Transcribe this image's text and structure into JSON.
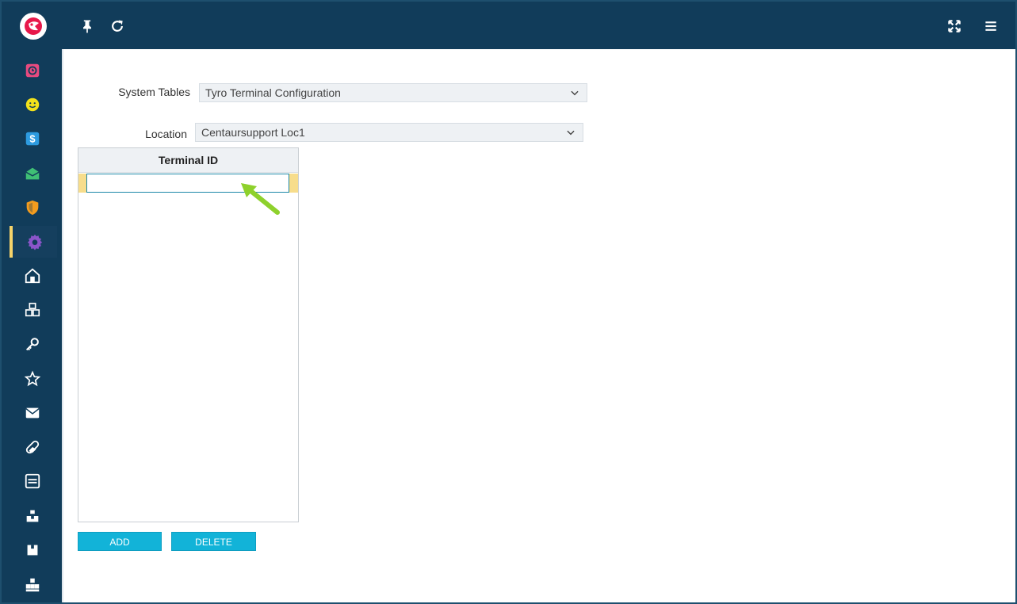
{
  "sidebar": {
    "items": [
      {
        "icon": "calendar-clock-icon",
        "color": "#e84a7f"
      },
      {
        "icon": "smiley-icon",
        "color": "#f3e21b"
      },
      {
        "icon": "dollar-icon",
        "color": "#2d9be0"
      },
      {
        "icon": "open-mail-icon",
        "color": "#3fbf75"
      },
      {
        "icon": "shield-icon",
        "color": "#f39c1e"
      },
      {
        "icon": "gear-icon",
        "color": "#8a55c9",
        "active": true
      },
      {
        "icon": "home-icon",
        "color": "#ffffff"
      },
      {
        "icon": "cubes-icon",
        "color": "#ffffff"
      },
      {
        "icon": "key-icon",
        "color": "#ffffff"
      },
      {
        "icon": "star-icon",
        "color": "#ffffff"
      },
      {
        "icon": "envelope-icon",
        "color": "#ffffff"
      },
      {
        "icon": "pill-icon",
        "color": "#ffffff"
      },
      {
        "icon": "list-box-icon",
        "color": "#ffffff"
      },
      {
        "icon": "hierarchy-icon",
        "color": "#ffffff"
      },
      {
        "icon": "box-icon",
        "color": "#ffffff"
      },
      {
        "icon": "boxes-stack-icon",
        "color": "#ffffff"
      }
    ]
  },
  "topbar": {
    "left_icons": [
      "pin-icon",
      "refresh-icon"
    ],
    "right_icons": [
      "fullscreen-icon",
      "menu-icon"
    ]
  },
  "form": {
    "system_tables_label": "System Tables",
    "system_tables_value": "Tyro Terminal Configuration",
    "location_label": "Location",
    "location_value": "Centaursupport Loc1"
  },
  "grid": {
    "header": "Terminal ID",
    "row_value": ""
  },
  "buttons": {
    "add": "ADD",
    "delete": "DELETE"
  },
  "colors": {
    "sidebar_bg": "#113c5a",
    "accent": "#12b3d8",
    "selected_row": "#f7dd8c",
    "arrow": "#8ed12c"
  }
}
